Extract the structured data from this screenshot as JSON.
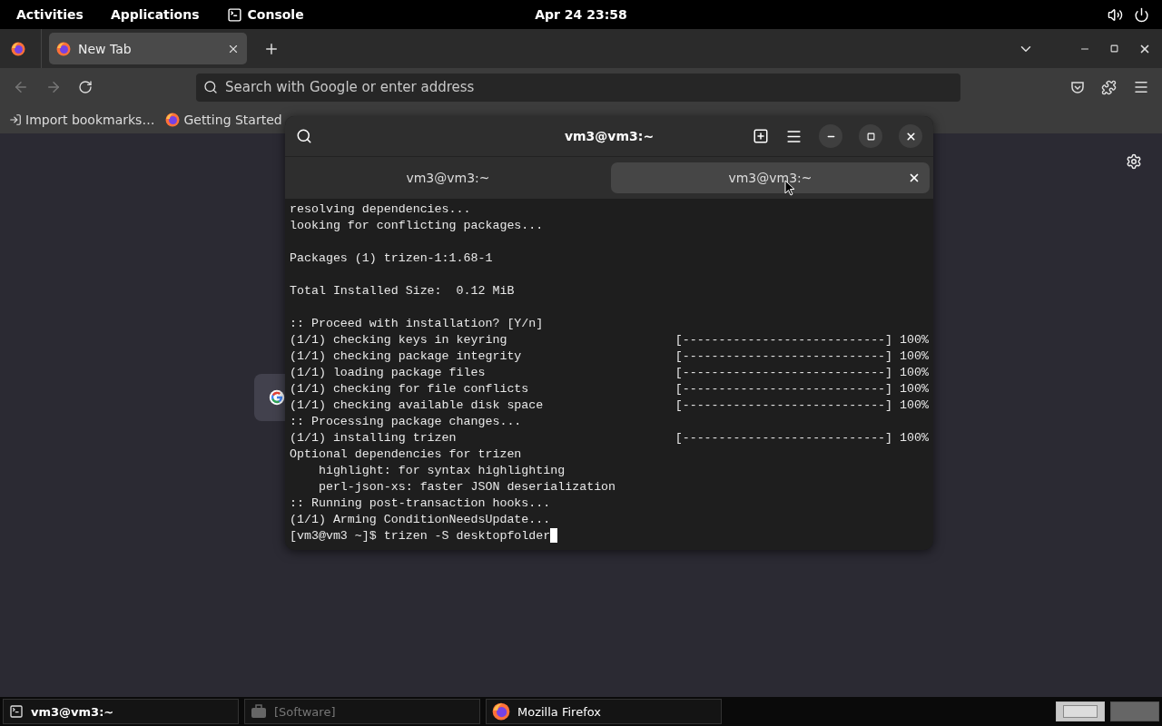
{
  "top_bar": {
    "activities": "Activities",
    "applications": "Applications",
    "app_name": "Console",
    "clock": "Apr 24  23:58"
  },
  "browser": {
    "tabs": [
      {
        "label": "New Tab",
        "selected": true
      }
    ],
    "address": {
      "placeholder": "Search with Google or enter address"
    },
    "bookmarks": [
      {
        "kind": "import",
        "label": "Import bookmarks…"
      },
      {
        "kind": "site",
        "label": "Getting Started"
      }
    ]
  },
  "terminal": {
    "title": "vm3@vm3:~",
    "tabs": [
      {
        "label": "vm3@vm3:~",
        "selected": false
      },
      {
        "label": "vm3@vm3:~",
        "selected": true
      }
    ],
    "lines": [
      {
        "kind": "text",
        "text": "resolving dependencies..."
      },
      {
        "kind": "text",
        "text": "looking for conflicting packages..."
      },
      {
        "kind": "blank"
      },
      {
        "kind": "text",
        "text": "Packages (1) trizen-1:1.68-1"
      },
      {
        "kind": "blank"
      },
      {
        "kind": "text",
        "text": "Total Installed Size:  0.12 MiB"
      },
      {
        "kind": "blank"
      },
      {
        "kind": "text",
        "text": ":: Proceed with installation? [Y/n]"
      },
      {
        "kind": "progress",
        "text": "(1/1) checking keys in keyring",
        "bar": "[----------------------------]",
        "percent": "100%"
      },
      {
        "kind": "progress",
        "text": "(1/1) checking package integrity",
        "bar": "[----------------------------]",
        "percent": "100%"
      },
      {
        "kind": "progress",
        "text": "(1/1) loading package files",
        "bar": "[----------------------------]",
        "percent": "100%"
      },
      {
        "kind": "progress",
        "text": "(1/1) checking for file conflicts",
        "bar": "[----------------------------]",
        "percent": "100%"
      },
      {
        "kind": "progress",
        "text": "(1/1) checking available disk space",
        "bar": "[----------------------------]",
        "percent": "100%"
      },
      {
        "kind": "text",
        "text": ":: Processing package changes..."
      },
      {
        "kind": "progress",
        "text": "(1/1) installing trizen",
        "bar": "[----------------------------]",
        "percent": "100%"
      },
      {
        "kind": "text",
        "text": "Optional dependencies for trizen"
      },
      {
        "kind": "text",
        "text": "    highlight: for syntax highlighting"
      },
      {
        "kind": "text",
        "text": "    perl-json-xs: faster JSON deserialization"
      },
      {
        "kind": "text",
        "text": ":: Running post-transaction hooks..."
      },
      {
        "kind": "text",
        "text": "(1/1) Arming ConditionNeedsUpdate..."
      },
      {
        "kind": "prompt",
        "text": "[vm3@vm3 ~]$ trizen -S desktopfolder"
      }
    ]
  },
  "taskbar": {
    "items": [
      {
        "kind": "terminal",
        "label": "vm3@vm3:~",
        "selected": true
      },
      {
        "kind": "software",
        "label": "[Software]",
        "selected": false
      },
      {
        "kind": "firefox",
        "label": "Mozilla Firefox",
        "selected": false
      }
    ],
    "workspaces": [
      {
        "selected": true
      },
      {
        "selected": false
      }
    ]
  }
}
